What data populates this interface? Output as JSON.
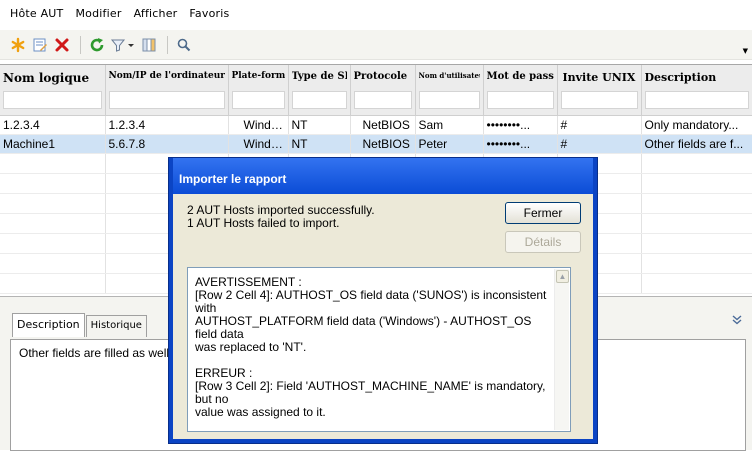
{
  "menu": [
    "Hôte AUT",
    "Modifier",
    "Afficher",
    "Favoris"
  ],
  "toolbar": {
    "icons": [
      "asterisk-new-icon",
      "edit-icon",
      "delete-x-icon",
      "refresh-icon",
      "filter-icon",
      "columns-icon",
      "search-icon"
    ]
  },
  "grid": {
    "columns": [
      "Nom logique",
      "Nom/IP de l'ordinateur",
      "Plate-forme",
      "Type de SE",
      "Protocole",
      "Nom d'utilisateur",
      "Mot de passe",
      "Invite UNIX",
      "Description"
    ],
    "rows": [
      [
        "1.2.3.4",
        "1.2.3.4",
        "Windows",
        "NT",
        "NetBIOS",
        "Sam",
        "••••••••...",
        "#",
        "Only mandatory..."
      ],
      [
        "Machine1",
        "5.6.7.8",
        "Windows",
        "NT",
        "NetBIOS",
        "Peter",
        "••••••••...",
        "#",
        "Other fields are f..."
      ]
    ]
  },
  "bottom": {
    "tabs": [
      "Description",
      "Historique"
    ],
    "description": "Other fields are filled as well"
  },
  "dialog": {
    "title": "Importer le rapport",
    "message_line1": "2 AUT Hosts imported successfully.",
    "message_line2": "1 AUT Hosts failed to import.",
    "close_button": "Fermer",
    "details_button": "Détails",
    "log": {
      "warn_header": "AVERTISSEMENT :",
      "warn_l1": "[Row 2 Cell 4]: AUTHOST_OS field data  ('SUNOS') is inconsistent with",
      "warn_l2": "AUTHOST_PLATFORM field data ('Windows') - AUTHOST_OS field data",
      "warn_l3": "was replaced to 'NT'.",
      "err_header": "ERREUR :",
      "err_l1": "[Row 3 Cell 2]: Field 'AUTHOST_MACHINE_NAME' is mandatory, but no",
      "err_l2": "value was assigned to it."
    }
  }
}
